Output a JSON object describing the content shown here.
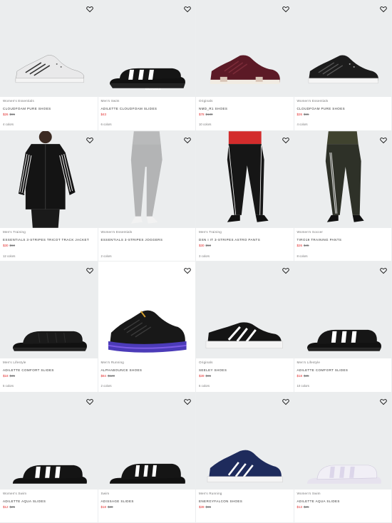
{
  "products": [
    {
      "category": "Women's Essentials",
      "name": "CLOUDFOAM PURE SHOES",
      "sale": "$26",
      "orig": "$65",
      "colors": "4 colors",
      "icon": "sneaker-white-knit-icon"
    },
    {
      "category": "Men's Swim",
      "name": "ADILETTE CLOUDFOAM SLIDES",
      "sale": "$43",
      "orig": "",
      "colors": "6 colors",
      "icon": "slide-adidas-icon"
    },
    {
      "category": "Originals",
      "name": "NMD_R1 SHOES",
      "sale": "$78",
      "orig": "$130",
      "colors": "10 colors",
      "icon": "sneaker-maroon-icon"
    },
    {
      "category": "Women's Essentials",
      "name": "CLOUDFOAM PURE SHOES",
      "sale": "$26",
      "orig": "$65",
      "colors": "4 colors",
      "icon": "sneaker-black-knit-icon"
    },
    {
      "category": "Men's Training",
      "name": "ESSENTIALS 3-STRIPES TRICOT TRACK JACKET",
      "sale": "$30",
      "orig": "$60",
      "colors": "12 colors",
      "icon": "track-jacket-icon"
    },
    {
      "category": "Women's Essentials",
      "name": "ESSENTIALS 3-STRIPES JOGGERS",
      "sale": "",
      "orig": "",
      "colors": "2 colors",
      "icon": "joggers-grey-icon"
    },
    {
      "category": "Men's Training",
      "name": "DSN I IT 3-STRIPES ASTRO PANTS",
      "sale": "$30",
      "orig": "$50",
      "colors": "3 colors",
      "icon": "pants-black-icon"
    },
    {
      "category": "Women's Soccer",
      "name": "TIRO19 TRAINING PANTS",
      "sale": "$26",
      "orig": "$45",
      "colors": "8 colors",
      "icon": "pants-olive-icon"
    },
    {
      "category": "Men's Lifestyle",
      "name": "ADILETTE COMFORT SLIDES",
      "sale": "$18",
      "orig": "$35",
      "colors": "5 colors",
      "icon": "slide-black-icon"
    },
    {
      "category": "Men's Running",
      "name": "ALPHABOUNCE SHOES",
      "sale": "$84",
      "orig": "$120",
      "colors": "2 colors",
      "icon": "sneaker-purple-sole-icon"
    },
    {
      "category": "Originals",
      "name": "SEELEY SHOES",
      "sale": "$39",
      "orig": "$65",
      "colors": "6 colors",
      "icon": "skate-shoe-icon"
    },
    {
      "category": "Men's Lifestyle",
      "name": "ADILETTE COMFORT SLIDES",
      "sale": "$18",
      "orig": "$35",
      "colors": "10 colors",
      "icon": "slide-stripes-icon"
    },
    {
      "category": "Women's Swim",
      "name": "ADILETTE AQUA SLIDES",
      "sale": "$12",
      "orig": "$25",
      "colors": "",
      "icon": "slide-aqua-black-icon"
    },
    {
      "category": "Swim",
      "name": "ADISSAGE SLIDES",
      "sale": "$18",
      "orig": "$30",
      "colors": "",
      "icon": "slide-adissage-icon"
    },
    {
      "category": "Men's Running",
      "name": "ENERGYFALCON SHOES",
      "sale": "$39",
      "orig": "$65",
      "colors": "",
      "icon": "sneaker-navy-icon"
    },
    {
      "category": "Women's Swim",
      "name": "ADILETTE AQUA SLIDES",
      "sale": "$13",
      "orig": "$25",
      "colors": "",
      "icon": "slide-white-lilac-icon"
    }
  ],
  "colors": {
    "sale": "#e32b2b",
    "image_bg": "#ebedee",
    "meta": "#767677"
  }
}
